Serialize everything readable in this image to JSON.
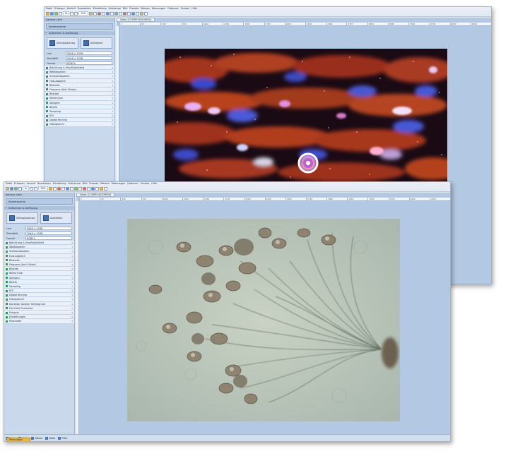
{
  "back_window": {
    "menu": [
      "Datei",
      "Erfassen",
      "Ansicht",
      "Bearbeiten",
      "Einstellung",
      "Aufnahme",
      "Bild",
      "Prozess",
      "Messen",
      "Messungen",
      "Optionen",
      "Fenster",
      "Hilfe"
    ],
    "toolbar": {
      "zoom": "fb",
      "zoom_pct": "30%"
    },
    "sidebar": {
      "header": "Kamera Liste",
      "title": "Kameraname",
      "section": "Aufnahme & Auflösung",
      "capture_buttons": [
        "Schnappschuss",
        "Aufnahme"
      ],
      "fields": [
        {
          "label": "Live",
          "value": "2048 × 1536"
        },
        {
          "label": "Standbild",
          "value": "2048 × 1536"
        },
        {
          "label": "Format",
          "value": "RGB24"
        }
      ],
      "items": [
        "Belichtung & Empfindlichkeit",
        "Weißabgleich",
        "Schwarzabgleich",
        "Farb-Abgleich",
        "Bildhelle",
        "Frequenz (Anti-Flicker)",
        "Bildrate",
        "Kühler/Line",
        "Spiegeln",
        "Bitiefe",
        "Sampling",
        "ROI",
        "Digital Binning",
        "Histogramm"
      ]
    },
    "tab": "Video [CU5PRO4000MON]",
    "ruler": [
      "0",
      "25",
      "500",
      "750",
      "1000",
      "1250",
      "1500",
      "1750",
      "2000",
      "2250",
      "2500",
      "2750",
      "3000",
      "3250",
      "3500",
      "3750",
      "4000",
      "4250"
    ]
  },
  "front_window": {
    "menu": [
      "Datei",
      "Erfassen",
      "Ansicht",
      "Bearbeiten",
      "Einstellung",
      "Aufnahme",
      "Bild",
      "Prozess",
      "Messen",
      "Messungen",
      "Optionen",
      "Fenster",
      "Hilfe"
    ],
    "toolbar": {
      "zoom": "fb",
      "zoom_pct": "36%"
    },
    "sidebar": {
      "header": "Kamera Liste",
      "title": "Kameraname",
      "section": "Aufnahme & Auflösung",
      "capture_buttons": [
        "Schnappschuss",
        "Aufnahme"
      ],
      "fields": [
        {
          "label": "Live",
          "value": "2048 × 1536"
        },
        {
          "label": "Standbild",
          "value": "2048 × 1536"
        },
        {
          "label": "Format",
          "value": "RGB24"
        }
      ],
      "items": [
        "Belichtung & Empfindlichkeit",
        "Weißabgleich",
        "Schwarzabgleich",
        "Farb-Abgleich",
        "Bildhelle",
        "Frequenz (Anti-Flicker)",
        "Bildrate",
        "Kühler/Line",
        "Spiegeln",
        "Bitiefe",
        "Sampling",
        "ROI",
        "Digital Binning",
        "Histogramm",
        "Korrektur dunkler Hintergrund",
        "Flat Field Correction",
        "Ereignis",
        "Einstellungen",
        "Parameter"
      ]
    },
    "tab": "Video [CU5PRO4000MON]",
    "ruler": [
      "0",
      "25",
      "500",
      "750",
      "1000",
      "1250",
      "1500",
      "1750",
      "2000",
      "2250",
      "2500",
      "2750",
      "3000",
      "3250",
      "3500",
      "3750",
      "4000",
      "4250"
    ],
    "statusbar": [
      "Datei",
      "Ordn.",
      "Album",
      "Datei",
      "Filter"
    ],
    "status_tab": "Messungen"
  }
}
